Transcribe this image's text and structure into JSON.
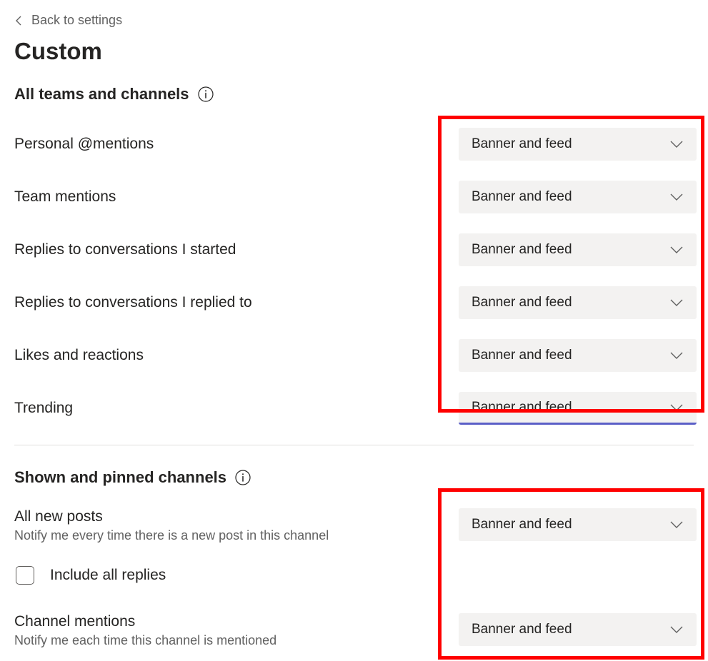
{
  "backLink": "Back to settings",
  "pageTitle": "Custom",
  "sections": {
    "allTeamsChannels": {
      "header": "All teams and channels",
      "rows": [
        {
          "label": "Personal @mentions",
          "value": "Banner and feed",
          "focused": false
        },
        {
          "label": "Team mentions",
          "value": "Banner and feed",
          "focused": false
        },
        {
          "label": "Replies to conversations I started",
          "value": "Banner and feed",
          "focused": false
        },
        {
          "label": "Replies to conversations I replied to",
          "value": "Banner and feed",
          "focused": false
        },
        {
          "label": "Likes and reactions",
          "value": "Banner and feed",
          "focused": false
        },
        {
          "label": "Trending",
          "value": "Banner and feed",
          "focused": true
        }
      ]
    },
    "shownPinnedChannels": {
      "header": "Shown and pinned channels",
      "allNewPosts": {
        "label": "All new posts",
        "sublabel": "Notify me every time there is a new post in this channel",
        "value": "Banner and feed"
      },
      "includeAllReplies": {
        "label": "Include all replies",
        "checked": false
      },
      "channelMentions": {
        "label": "Channel mentions",
        "sublabel": "Notify me each time this channel is mentioned",
        "value": "Banner and feed"
      }
    }
  }
}
